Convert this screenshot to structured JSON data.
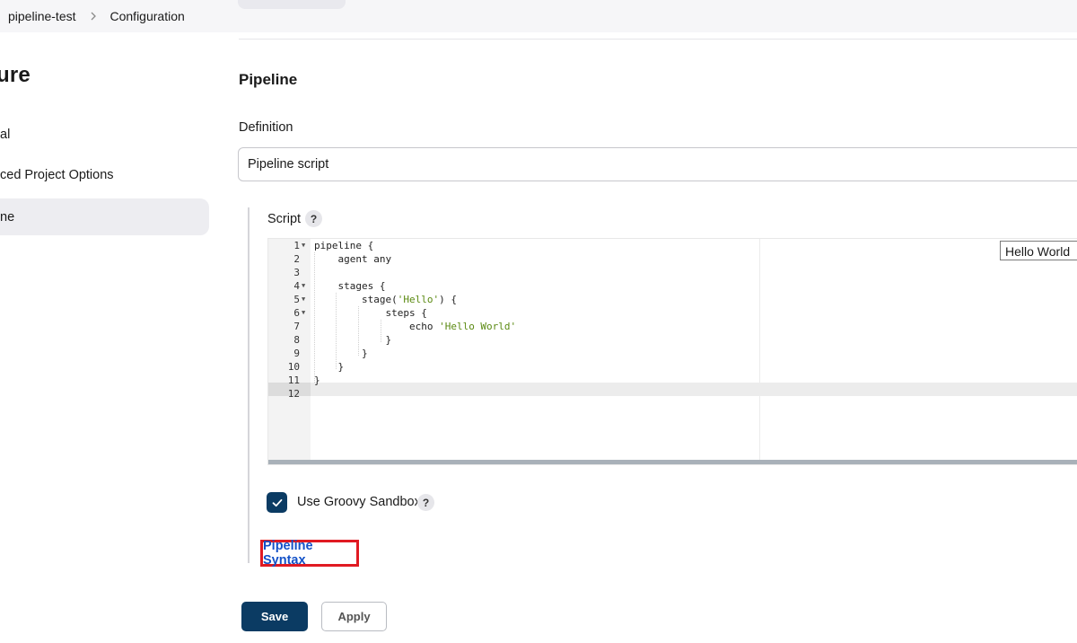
{
  "breadcrumb": {
    "items": [
      "pipeline-test",
      "Configuration"
    ]
  },
  "sidebar": {
    "title": "ure",
    "items": [
      {
        "label": "al"
      },
      {
        "label": "ced Project Options"
      },
      {
        "label": "ne",
        "active": true
      }
    ]
  },
  "main": {
    "section_title": "Pipeline",
    "definition_label": "Definition",
    "definition_value": "Pipeline script",
    "script_label": "Script",
    "help_glyph": "?",
    "editor": {
      "lines": [
        {
          "n": "1",
          "fold": true,
          "text": "pipeline {"
        },
        {
          "n": "2",
          "fold": false,
          "text": "    agent any"
        },
        {
          "n": "3",
          "fold": false,
          "text": ""
        },
        {
          "n": "4",
          "fold": true,
          "text": "    stages {"
        },
        {
          "n": "5",
          "fold": true,
          "pre": "        stage(",
          "str": "'Hello'",
          "post": ") {"
        },
        {
          "n": "6",
          "fold": true,
          "text": "            steps {"
        },
        {
          "n": "7",
          "fold": false,
          "pre": "                echo ",
          "str": "'Hello World'",
          "post": ""
        },
        {
          "n": "8",
          "fold": false,
          "text": "            }"
        },
        {
          "n": "9",
          "fold": false,
          "text": "        }"
        },
        {
          "n": "10",
          "fold": false,
          "text": "    }"
        },
        {
          "n": "11",
          "fold": false,
          "text": "}"
        },
        {
          "n": "12",
          "fold": false,
          "text": ""
        }
      ],
      "active_line": 12
    },
    "tooltip_text": "Hello World",
    "sandbox_label": "Use Groovy Sandbox",
    "sandbox_checked": true,
    "syntax_link": "Pipeline Syntax"
  },
  "actions": {
    "save_label": "Save",
    "apply_label": "Apply"
  },
  "colors": {
    "primary": "#0b3b63",
    "link": "#1452c8",
    "highlight_border": "#e01a22",
    "string": "#5b8a12"
  },
  "icons": {
    "breadcrumb_separator": "chevron-right-icon",
    "help": "question-mark-icon",
    "checkbox": "check-icon",
    "fold": "fold-arrow-icon"
  }
}
